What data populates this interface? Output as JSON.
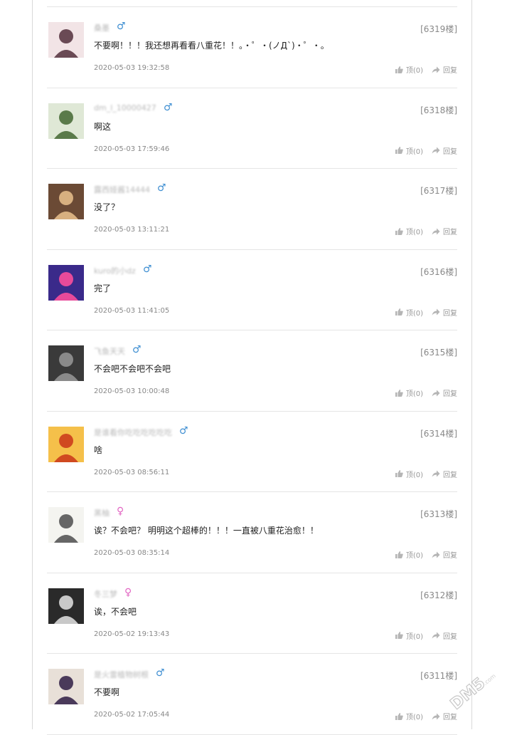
{
  "comments": [
    {
      "user": "桑墨",
      "gender": "male",
      "gender_symbol": "♂",
      "floor": "[6319楼]",
      "content": "不要啊！！！我还想再看看八重花！！。・゜・(ノД`)・゜・。",
      "time": "2020-05-03 19:32:58",
      "like_label": "顶(0)",
      "reply_label": "回复",
      "avatar": {
        "bg": "#f2e4e6",
        "fg": "#6a4a55"
      }
    },
    {
      "user": "dm_l_10000427",
      "gender": "male",
      "gender_symbol": "♂",
      "floor": "[6318楼]",
      "content": "啊这",
      "time": "2020-05-03 17:59:46",
      "like_label": "顶(0)",
      "reply_label": "回复",
      "avatar": {
        "bg": "#dfe8d6",
        "fg": "#5a7a4a"
      }
    },
    {
      "user": "露西娅酱14444",
      "gender": "male",
      "gender_symbol": "♂",
      "floor": "[6317楼]",
      "content": "没了？",
      "time": "2020-05-03 13:11:21",
      "like_label": "顶(0)",
      "reply_label": "回复",
      "avatar": {
        "bg": "#6b4a35",
        "fg": "#d8b080"
      }
    },
    {
      "user": "kuro的小dz",
      "gender": "male",
      "gender_symbol": "♂",
      "floor": "[6316楼]",
      "content": "完了",
      "time": "2020-05-03 11:41:05",
      "like_label": "顶(0)",
      "reply_label": "回复",
      "avatar": {
        "bg": "#3a2a8a",
        "fg": "#e84a9a"
      }
    },
    {
      "user": "飞鱼天天",
      "gender": "male",
      "gender_symbol": "♂",
      "floor": "[6315楼]",
      "content": "不会吧不会吧不会吧",
      "time": "2020-05-03 10:00:48",
      "like_label": "顶(0)",
      "reply_label": "回复",
      "avatar": {
        "bg": "#3a3a3a",
        "fg": "#8a8a8a"
      }
    },
    {
      "user": "是谁看你吃吃吃吃吃吃",
      "gender": "male",
      "gender_symbol": "♂",
      "floor": "[6314楼]",
      "content": "啥",
      "time": "2020-05-03 08:56:11",
      "like_label": "顶(0)",
      "reply_label": "回复",
      "avatar": {
        "bg": "#f5c04a",
        "fg": "#d04a20"
      }
    },
    {
      "user": "黑柚",
      "gender": "female",
      "gender_symbol": "♀",
      "floor": "[6313楼]",
      "content": "诶？不会吧？ 明明这个超棒的！！！一直被八重花治愈！！",
      "time": "2020-05-03 08:35:14",
      "like_label": "顶(0)",
      "reply_label": "回复",
      "avatar": {
        "bg": "#f4f4f0",
        "fg": "#666"
      }
    },
    {
      "user": "冬三梦",
      "gender": "female",
      "gender_symbol": "♀",
      "floor": "[6312楼]",
      "content": "诶，不会吧",
      "time": "2020-05-02 19:13:43",
      "like_label": "顶(0)",
      "reply_label": "回复",
      "avatar": {
        "bg": "#2a2a2a",
        "fg": "#c8c8c8"
      }
    },
    {
      "user": "是火雷植物树根",
      "gender": "male",
      "gender_symbol": "♂",
      "floor": "[6311楼]",
      "content": "不要啊",
      "time": "2020-05-02 17:05:44",
      "like_label": "顶(0)",
      "reply_label": "回复",
      "avatar": {
        "bg": "#e8e0d8",
        "fg": "#4a3a5a"
      }
    }
  ],
  "watermark": "DM5.com"
}
